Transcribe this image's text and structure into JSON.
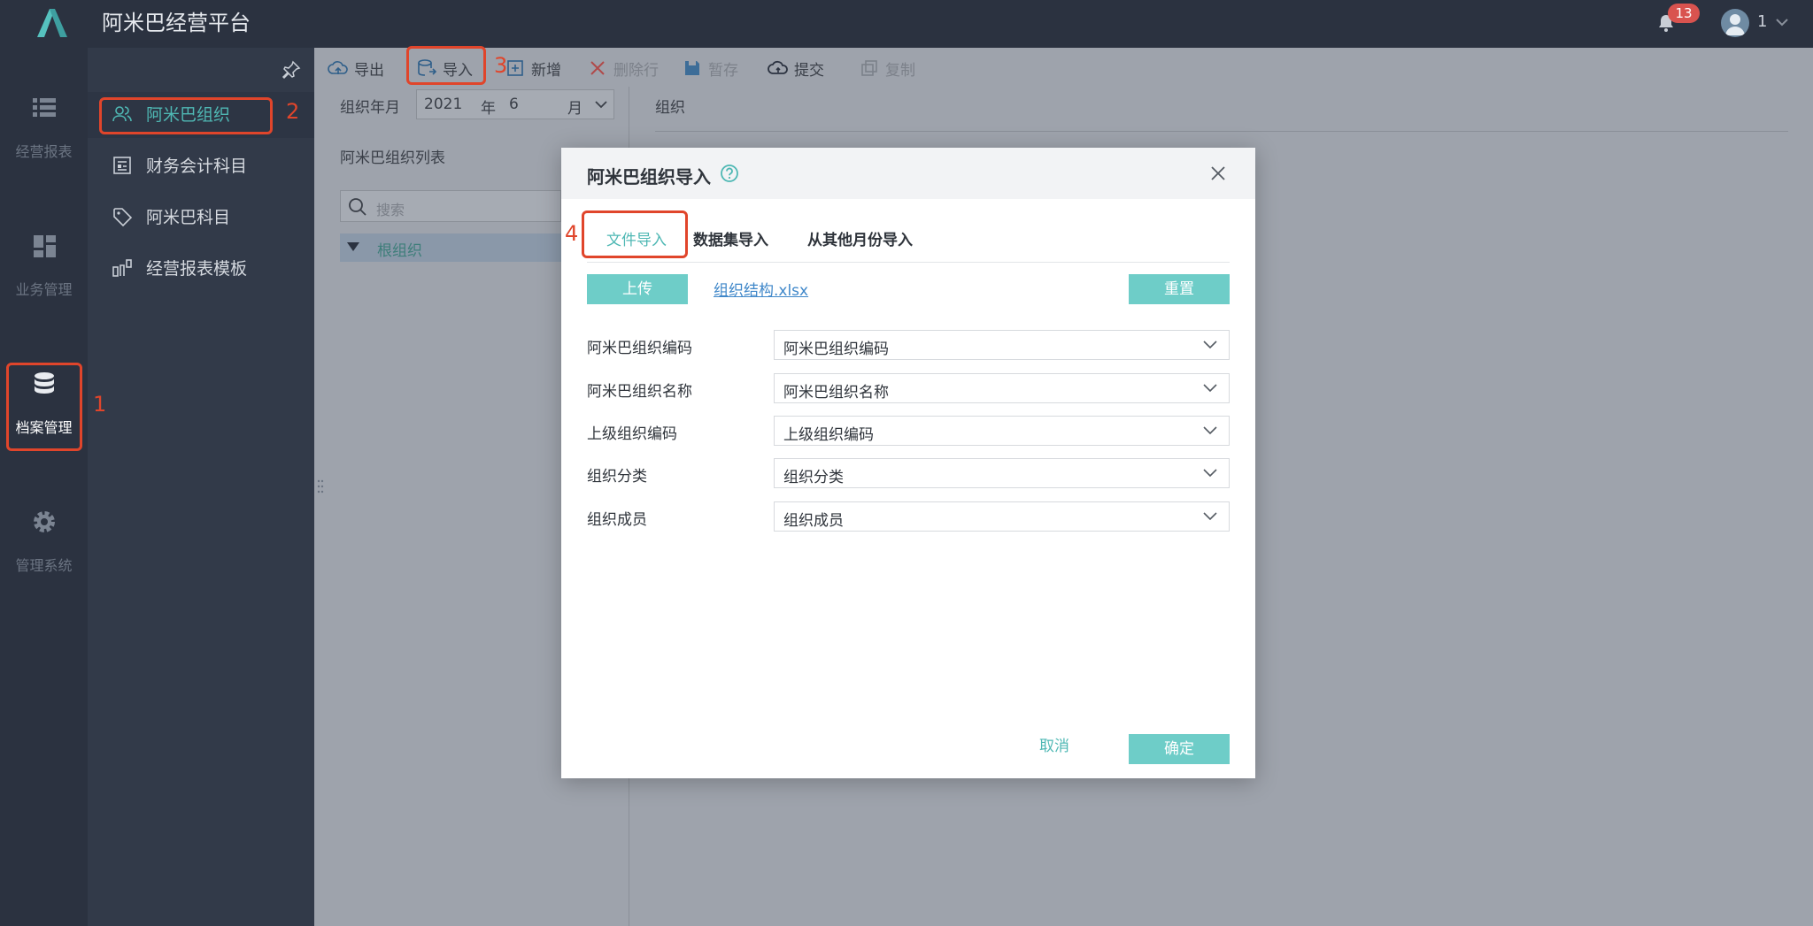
{
  "app": {
    "title": "阿米巴经营平台"
  },
  "header": {
    "notification_count": "13",
    "user_name": "1"
  },
  "main_nav": {
    "items": [
      {
        "label": "经营报表",
        "icon": "list-icon"
      },
      {
        "label": "业务管理",
        "icon": "dashboard-icon"
      },
      {
        "label": "档案管理",
        "icon": "database-icon",
        "active": true
      },
      {
        "label": "管理系统",
        "icon": "gear-icon"
      }
    ]
  },
  "sub_nav": {
    "items": [
      {
        "label": "阿米巴组织",
        "icon": "users-icon",
        "active": true
      },
      {
        "label": "财务会计科目",
        "icon": "ledger-icon"
      },
      {
        "label": "阿米巴科目",
        "icon": "tag-icon"
      },
      {
        "label": "经营报表模板",
        "icon": "template-icon"
      }
    ]
  },
  "toolbar": {
    "export": "导出",
    "import": "导入",
    "add": "新增",
    "delete_row": "删除行",
    "save_draft": "暂存",
    "submit": "提交",
    "copy": "复制"
  },
  "filter": {
    "label": "组织年月",
    "year": "2021",
    "year_unit": "年",
    "month": "6",
    "month_unit": "月"
  },
  "org_list": {
    "title": "阿米巴组织列表",
    "search_placeholder": "搜索",
    "root": "根组织"
  },
  "right_panel": {
    "label": "组织"
  },
  "steps": {
    "s1": "1",
    "s2": "2",
    "s3": "3",
    "s4": "4"
  },
  "modal": {
    "title": "阿米巴组织导入",
    "tabs": [
      "文件导入",
      "数据集导入",
      "从其他月份导入"
    ],
    "upload": "上传",
    "file_name": "组织结构.xlsx",
    "reset": "重置",
    "fields": [
      {
        "label": "阿米巴组织编码",
        "value": "阿米巴组织编码"
      },
      {
        "label": "阿米巴组织名称",
        "value": "阿米巴组织名称"
      },
      {
        "label": "上级组织编码",
        "value": "上级组织编码"
      },
      {
        "label": "组织分类",
        "value": "组织分类"
      },
      {
        "label": "组织成员",
        "value": "组织成员"
      }
    ],
    "cancel": "取消",
    "confirm": "确定"
  },
  "colors": {
    "accent": "#6ecdc8",
    "annotation": "#e0452b",
    "sidebar": "#2b3240"
  }
}
